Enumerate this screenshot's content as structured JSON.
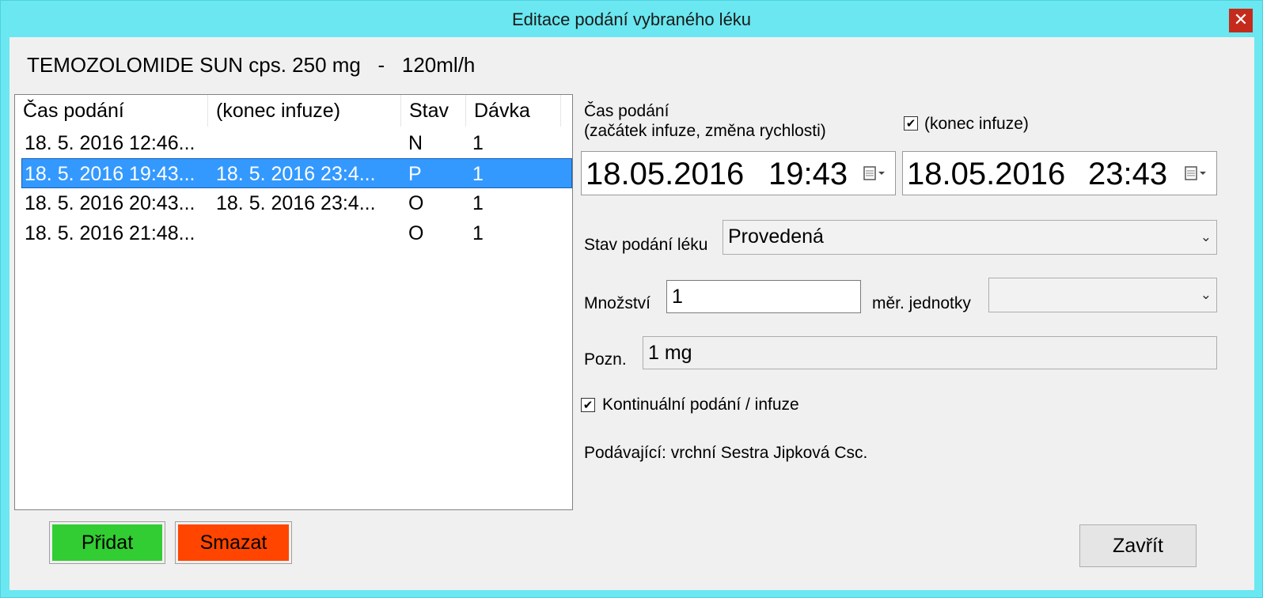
{
  "window": {
    "title": "Editace podání vybraného léku",
    "close_glyph": "✕"
  },
  "drug": {
    "name": "TEMOZOLOMIDE SUN cps. 250 mg",
    "separator": "-",
    "rate": "120ml/h"
  },
  "list": {
    "columns": [
      "Čas podání",
      "(konec infuze)",
      "Stav",
      "Dávka"
    ],
    "rows": [
      {
        "time": "18. 5. 2016 12:46...",
        "end": "",
        "status": "N",
        "dose": "1"
      },
      {
        "time": "18. 5. 2016 19:43...",
        "end": "18. 5. 2016 23:4...",
        "status": "P",
        "dose": "1"
      },
      {
        "time": "18. 5. 2016 20:43...",
        "end": "18. 5. 2016 23:4...",
        "status": "O",
        "dose": "1"
      },
      {
        "time": "18. 5. 2016 21:48...",
        "end": "",
        "status": "O",
        "dose": "1"
      }
    ],
    "selected_index": 1
  },
  "form": {
    "time_label_1": "Čas podání",
    "time_label_2": "(začátek infuze, změna rychlosti)",
    "end_checkbox_label": "(konec infuze)",
    "end_checked": true,
    "start_date": "18.05.2016",
    "start_time": "19:43",
    "end_date": "18.05.2016",
    "end_time": "23:43",
    "status_label": "Stav podání léku",
    "status_value": "Provedená",
    "qty_label": "Množství",
    "qty_value": "1",
    "unit_label": "měr. jednotky",
    "unit_value": "",
    "note_label": "Pozn.",
    "note_value": "1 mg",
    "continuous_label": "Kontinuální podání / infuze",
    "continuous_checked": true,
    "administrator": "Podávající: vrchní Sestra Jipková Csc."
  },
  "buttons": {
    "add": "Přidat",
    "delete": "Smazat",
    "close": "Zavřít"
  },
  "glyphs": {
    "check": "✔",
    "dropdown": "⌄"
  },
  "colors": {
    "titlebar": "#6ae7f0",
    "selection": "#3399ff",
    "add": "#32cd32",
    "delete": "#ff4500",
    "close_x": "#c42b1c"
  }
}
